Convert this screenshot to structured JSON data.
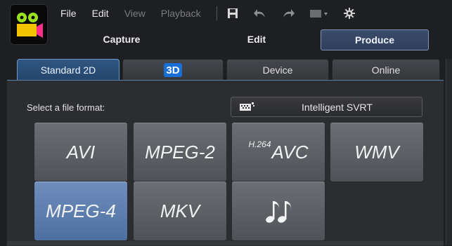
{
  "menu": {
    "file": "File",
    "edit": "Edit",
    "view": "View",
    "playback": "Playback"
  },
  "toolbar_icons": [
    "save-icon",
    "undo-icon",
    "redo-icon",
    "snapshot-icon",
    "settings-icon"
  ],
  "modes": {
    "capture": "Capture",
    "edit": "Edit",
    "produce": "Produce",
    "active": "produce"
  },
  "tabs": {
    "standard2d": "Standard 2D",
    "three_d": "3D",
    "device": "Device",
    "online": "Online",
    "active": "standard2d"
  },
  "panel": {
    "select_label": "Select a file format:",
    "svrt_label": "Intelligent SVRT"
  },
  "formats": {
    "avi": "AVI",
    "mpeg2": "MPEG-2",
    "h264_prefix": "H.264",
    "avc": "AVC",
    "wmv": "WMV",
    "mpeg4": "MPEG-4",
    "mkv": "MKV",
    "audio_icon": "music-notes-icon",
    "selected": "mpeg4"
  },
  "colors": {
    "accent": "#5c7fa8",
    "selected_button": "#5f7fae"
  }
}
